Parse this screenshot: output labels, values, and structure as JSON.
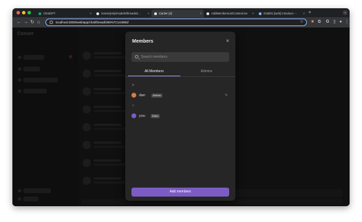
{
  "browser": {
    "tabs": [
      {
        "label": "ChatGPT",
        "favicon_color": "#10a37f"
      },
      {
        "label": "/users/jesly/models/threaded…",
        "favicon_color": "#e8e8e8"
      },
      {
        "label": "Carrier (2)",
        "favicon_color": "#e8e8e8"
      },
      {
        "label": "AddMembersListContent.tsx",
        "favicon_color": "#e8e8e8"
      },
      {
        "label": "015801 [web] introduce ⋯",
        "favicon_color": "#8ab4f8"
      }
    ],
    "url": "localhost:3000/web/app/chat/thread/298%7C144883/",
    "new_tab_label": "+"
  },
  "app": {
    "sidebar_title": "Conver"
  },
  "modal": {
    "title": "Members",
    "close_glyph": "×",
    "search_placeholder": "Search members",
    "tabs": [
      "All Members",
      "Admins"
    ],
    "sections": [
      {
        "letter": "D",
        "members": [
          {
            "name": "dan",
            "role": "Admins",
            "avatar_color": "#d87a4a"
          }
        ]
      },
      {
        "letter": "Y",
        "members": [
          {
            "name": "you",
            "role": "Editor",
            "avatar_color": "#7b5cc6"
          }
        ]
      }
    ],
    "add_button_label": "Add members",
    "accent_color": "#7c5cc4"
  }
}
